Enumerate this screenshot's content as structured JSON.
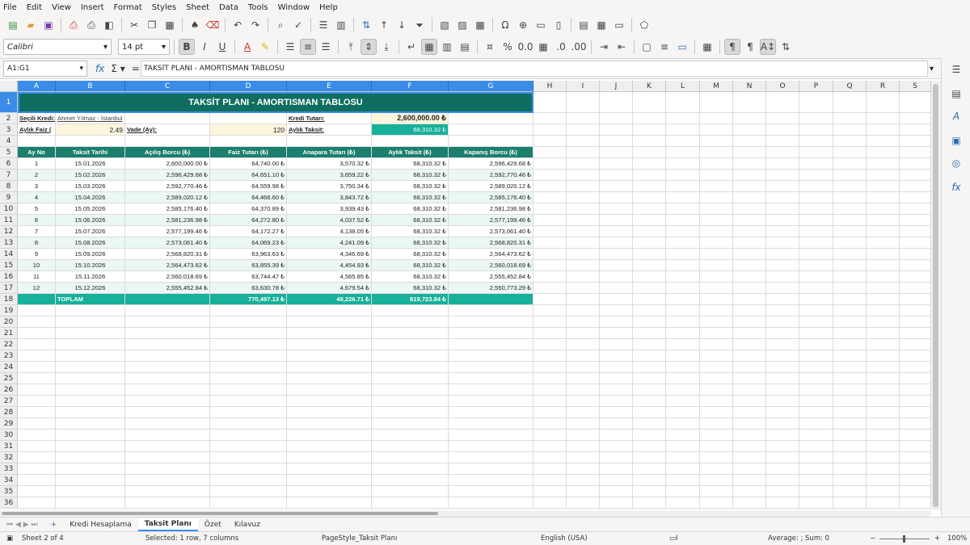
{
  "menu": [
    "File",
    "Edit",
    "View",
    "Insert",
    "Format",
    "Styles",
    "Sheet",
    "Data",
    "Tools",
    "Window",
    "Help"
  ],
  "toolbar": {
    "font_name": "Calibri",
    "font_size": "14 pt"
  },
  "formula": {
    "cell_ref": "A1:G1",
    "content": "TAKSİT PLANI - AMORTISMAN TABLOSU"
  },
  "columns": [
    "A",
    "B",
    "C",
    "D",
    "E",
    "F",
    "G",
    "H",
    "I",
    "J",
    "K",
    "L",
    "M",
    "N",
    "O",
    "P",
    "Q",
    "R",
    "S"
  ],
  "rows": [
    "1",
    "2",
    "3",
    "4",
    "5",
    "6",
    "7",
    "8",
    "9",
    "10",
    "11",
    "12",
    "13",
    "14",
    "15",
    "16",
    "17",
    "18",
    "19",
    "20",
    "21",
    "22",
    "23",
    "24",
    "25",
    "26",
    "27",
    "28",
    "29",
    "30",
    "31",
    "32",
    "33",
    "34",
    "35",
    "36"
  ],
  "sheet": {
    "title": "TAKSİT PLANI - AMORTISMAN TABLOSU",
    "info": {
      "loan_label": "Seçili Kredi:",
      "loan_name": "Ahmet Yılmaz - İstanbul",
      "amount_label": "Kredi Tutarı:",
      "amount_value": "2,600,000.00 ₺",
      "rate_label": "Aylık Faiz (",
      "rate_value": "2.49",
      "term_label": "Vade (Ay):",
      "term_value": "120",
      "payment_label": "Aylık Taksit:",
      "payment_value": "68,310.32 ₺"
    },
    "headers": [
      "Ay No",
      "Taksit Tarihi",
      "Açılış Borcu (₺)",
      "Faiz Tutarı (₺)",
      "Anapara Tutarı (₺)",
      "Aylık Taksit (₺)",
      "Kapanış Borcu (₺)"
    ],
    "rows": [
      [
        "1",
        "15.01.2026",
        "2,600,000.00 ₺",
        "64,740.00 ₺",
        "3,570.32 ₺",
        "68,310.32 ₺",
        "2,596,429.68 ₺"
      ],
      [
        "2",
        "15.02.2026",
        "2,596,429.68 ₺",
        "64,651.10 ₺",
        "3,659.22 ₺",
        "68,310.32 ₺",
        "2,592,770.46 ₺"
      ],
      [
        "3",
        "15.03.2026",
        "2,592,770.46 ₺",
        "64,559.98 ₺",
        "3,750.34 ₺",
        "68,310.32 ₺",
        "2,589,020.12 ₺"
      ],
      [
        "4",
        "15.04.2026",
        "2,589,020.12 ₺",
        "64,466.60 ₺",
        "3,843.72 ₺",
        "68,310.32 ₺",
        "2,585,176.40 ₺"
      ],
      [
        "5",
        "15.05.2026",
        "2,585,176.40 ₺",
        "64,370.89 ₺",
        "3,939.43 ₺",
        "68,310.32 ₺",
        "2,581,236.98 ₺"
      ],
      [
        "6",
        "15.06.2026",
        "2,581,236.98 ₺",
        "64,272.80 ₺",
        "4,037.52 ₺",
        "68,310.32 ₺",
        "2,577,199.46 ₺"
      ],
      [
        "7",
        "15.07.2026",
        "2,577,199.46 ₺",
        "64,172.27 ₺",
        "4,138.05 ₺",
        "68,310.32 ₺",
        "2,573,061.40 ₺"
      ],
      [
        "8",
        "15.08.2026",
        "2,573,061.40 ₺",
        "64,069.23 ₺",
        "4,241.09 ₺",
        "68,310.32 ₺",
        "2,568,820.31 ₺"
      ],
      [
        "9",
        "15.09.2026",
        "2,568,820.31 ₺",
        "63,963.63 ₺",
        "4,346.69 ₺",
        "68,310.32 ₺",
        "2,564,473.62 ₺"
      ],
      [
        "10",
        "15.10.2026",
        "2,564,473.62 ₺",
        "63,855.39 ₺",
        "4,454.93 ₺",
        "68,310.32 ₺",
        "2,560,018.69 ₺"
      ],
      [
        "11",
        "15.11.2026",
        "2,560,018.69 ₺",
        "63,744.47 ₺",
        "4,565.85 ₺",
        "68,310.32 ₺",
        "2,555,452.84 ₺"
      ],
      [
        "12",
        "15.12.2026",
        "2,555,452.84 ₺",
        "63,630.78 ₺",
        "4,679.54 ₺",
        "68,310.32 ₺",
        "2,550,773.29 ₺"
      ]
    ],
    "total": {
      "label": "TOPLAM",
      "interest": "770,497.13 ₺",
      "principal": "49,226.71 ₺",
      "payment": "819,723.84 ₺"
    }
  },
  "tabs": [
    "Kredi Hesaplama",
    "Taksit Planı",
    "Özet",
    "Kılavuz"
  ],
  "active_tab": "Taksit Planı",
  "status": {
    "sheet": "Sheet 2 of 4",
    "selection": "Selected: 1 row, 7 columns",
    "page_style": "PageStyle_Taksit Planı",
    "language": "English (USA)",
    "sum": "Average: ; Sum: 0",
    "zoom": "100%"
  },
  "colors": {
    "title_bg": "#0f6e5f",
    "header_bg": "#1a7f6e",
    "accent": "#17b09b",
    "row_alt": "#eaf7f2",
    "input_bg": "#fdf5dc",
    "selection": "#3b8ce8"
  }
}
